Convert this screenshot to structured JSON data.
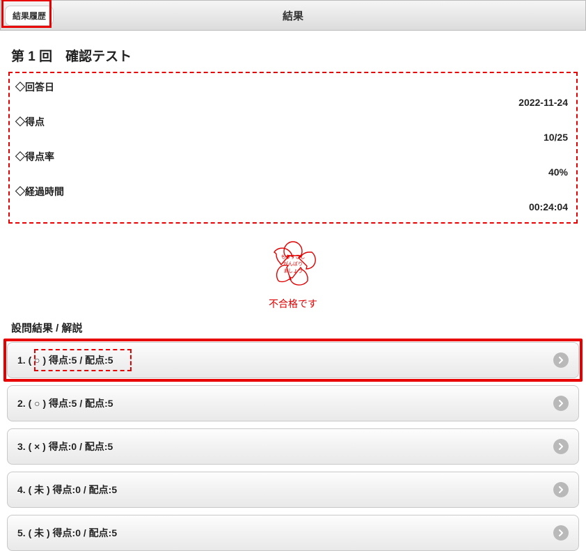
{
  "header": {
    "back_label": "結果履歴",
    "title": "結果"
  },
  "page_title": "第 1 回　確認テスト",
  "summary": {
    "date_label": "◇回答日",
    "date_value": "2022-11-24",
    "score_label": "◇得点",
    "score_value": "10/25",
    "rate_label": "◇得点率",
    "rate_value": "40%",
    "time_label": "◇経過時間",
    "time_value": "00:24:04"
  },
  "stamp": {
    "status_text": "不合格です",
    "inner_text": "もうすこしがんばりましょう"
  },
  "section_header": "設問結果 / 解説",
  "questions": [
    {
      "text": "1. ( ○ ) 得点:5 / 配点:5"
    },
    {
      "text": "2. ( ○ ) 得点:5 / 配点:5"
    },
    {
      "text": "3. ( × ) 得点:0 / 配点:5"
    },
    {
      "text": "4. ( 未 ) 得点:0 / 配点:5"
    },
    {
      "text": "5. ( 未 ) 得点:0 / 配点:5"
    }
  ]
}
